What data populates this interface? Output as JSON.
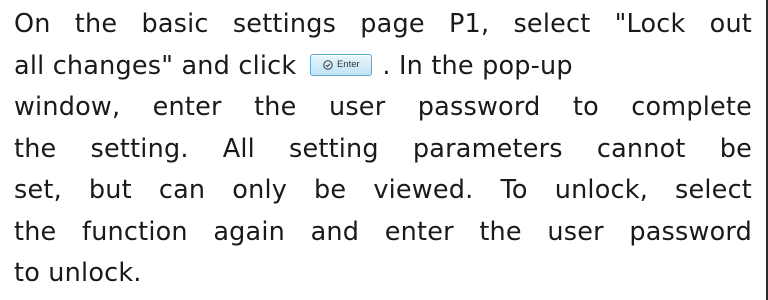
{
  "paragraph": {
    "line1": "On the basic settings page P1, select \"Lock out",
    "line2_before": "all changes\" and click",
    "line2_after": ". In the pop-up",
    "line3": "window, enter the user password to complete",
    "line4": "the setting. All setting parameters cannot be",
    "line5": "set, but can only be viewed. To unlock, select",
    "line6": "the function again and enter the user password",
    "line7": "to unlock."
  },
  "enter_button": {
    "label": "Enter",
    "icon": "check-circle-icon",
    "colors": {
      "border": "#5fa9d6",
      "fill_top": "#e9f6fd",
      "fill_bottom": "#bfe3f6",
      "icon": "#3a3a3a"
    }
  }
}
